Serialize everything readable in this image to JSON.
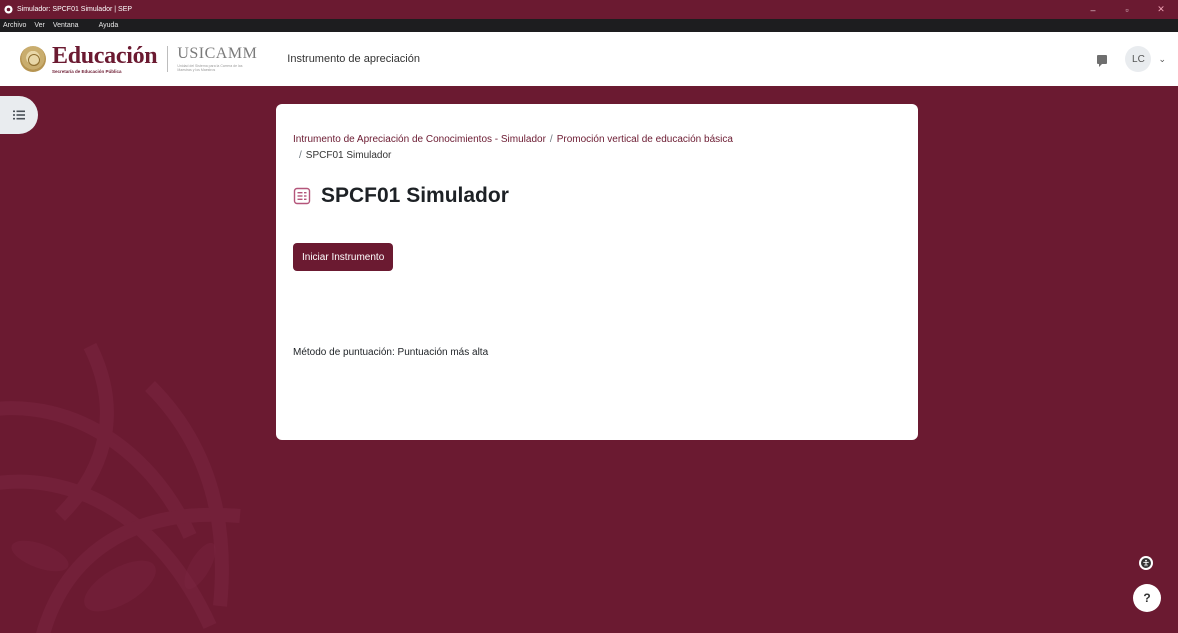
{
  "window": {
    "title": "Simulador: SPCF01 Simulador | SEP",
    "minimize": "–",
    "maximize": "▫",
    "close": "✕"
  },
  "menubar": {
    "items": [
      "Archivo",
      "Ver",
      "Ventana",
      "Ayuda"
    ]
  },
  "navbar": {
    "brand": "Educación",
    "brand_sub": "Secretaría de Educación Pública",
    "usicamm": "USICAMM",
    "usicamm_tag": "Unidad del Sistema para la Carrera de las Maestras y los Maestros",
    "title": "Instrumento de apreciación",
    "avatar_initials": "LC",
    "chevron": "⌄"
  },
  "breadcrumb": {
    "items": [
      "Intrumento de Apreciación de Conocimientos - Simulador",
      "Promoción vertical de educación básica",
      "SPCF01 Simulador"
    ],
    "separator": "/"
  },
  "page": {
    "title": "SPCF01 Simulador",
    "start_button": "Iniciar Instrumento",
    "grading_method": "Método de puntuación: Puntuación más alta"
  },
  "help": {
    "label": "?"
  },
  "colors": {
    "brand": "#6b1a31",
    "menubar": "#1d1d1f",
    "card": "#ffffff"
  },
  "icons": [
    "app-icon",
    "drawer-list-icon",
    "quiz-icon",
    "chat-icon",
    "accessibility-icon",
    "help-icon"
  ]
}
